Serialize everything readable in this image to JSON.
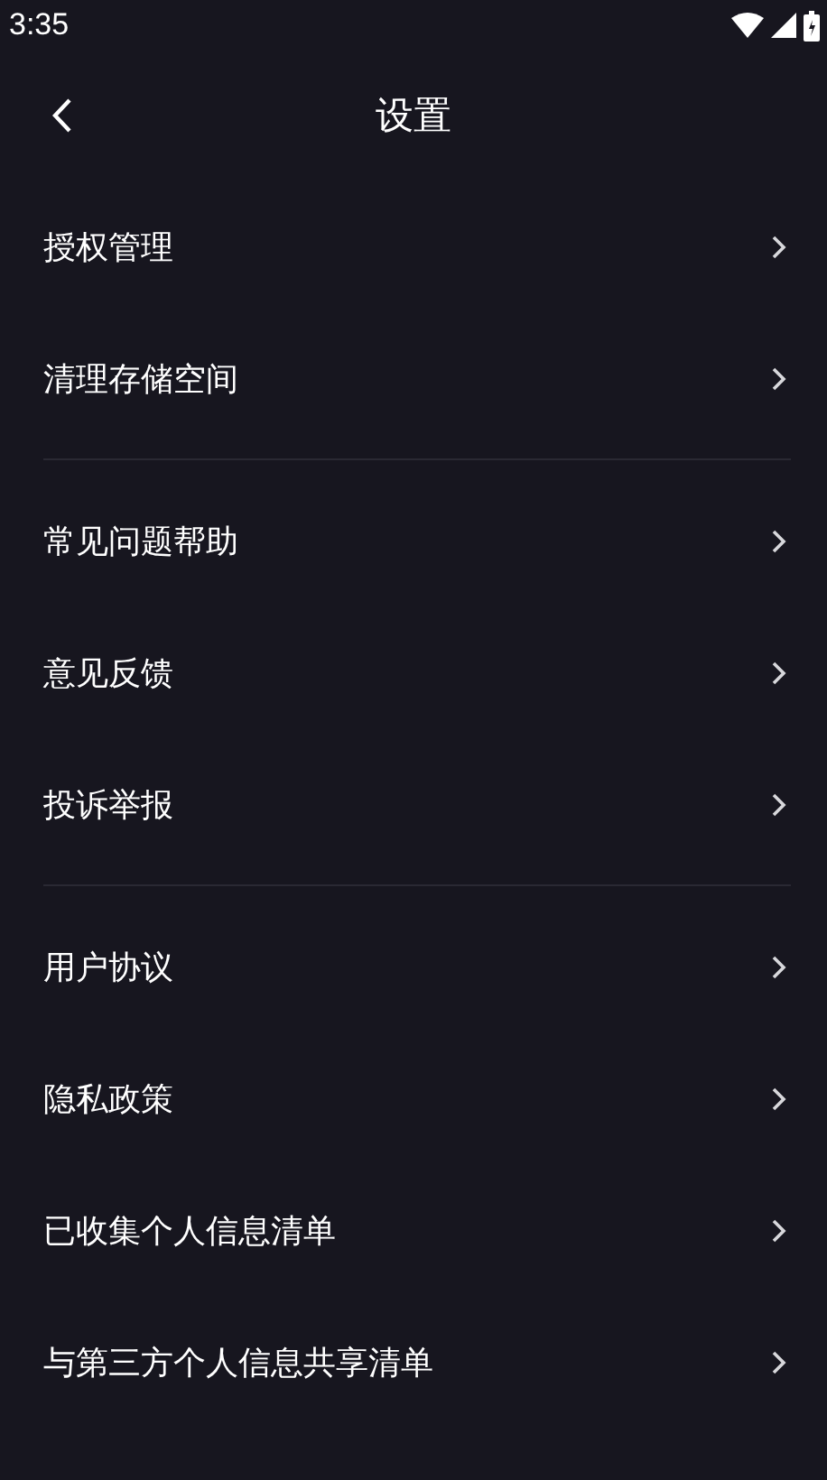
{
  "status_bar": {
    "time": "3:35"
  },
  "header": {
    "title": "设置"
  },
  "groups": [
    {
      "items": [
        {
          "label": "授权管理"
        },
        {
          "label": "清理存储空间"
        }
      ]
    },
    {
      "items": [
        {
          "label": "常见问题帮助"
        },
        {
          "label": "意见反馈"
        },
        {
          "label": "投诉举报"
        }
      ]
    },
    {
      "items": [
        {
          "label": "用户协议"
        },
        {
          "label": "隐私政策"
        },
        {
          "label": "已收集个人信息清单"
        },
        {
          "label": "与第三方个人信息共享清单"
        }
      ]
    }
  ]
}
